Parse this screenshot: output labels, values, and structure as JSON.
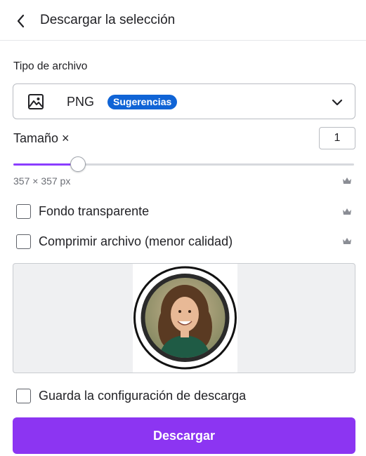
{
  "header": {
    "title": "Descargar la selección",
    "back_icon": "chevron-left-icon"
  },
  "file_type": {
    "label": "Tipo de archivo",
    "selected": "PNG",
    "badge": "Sugerencias",
    "icon": "image-icon",
    "dropdown_icon": "chevron-down-icon"
  },
  "size": {
    "label": "Tamaño ×",
    "value": "1",
    "slider_fraction": 0.19,
    "dimensions": "357 × 357 px"
  },
  "options": [
    {
      "label": "Fondo transparente",
      "checked": false,
      "premium": true
    },
    {
      "label": "Comprimir archivo (menor calidad)",
      "checked": false,
      "premium": true
    }
  ],
  "save_settings": {
    "label": "Guarda la configuración de descarga",
    "checked": false
  },
  "download_button": {
    "label": "Descargar"
  },
  "colors": {
    "accent": "#8c35f2",
    "badge": "#1064d6",
    "slider": "#8b3dff"
  }
}
